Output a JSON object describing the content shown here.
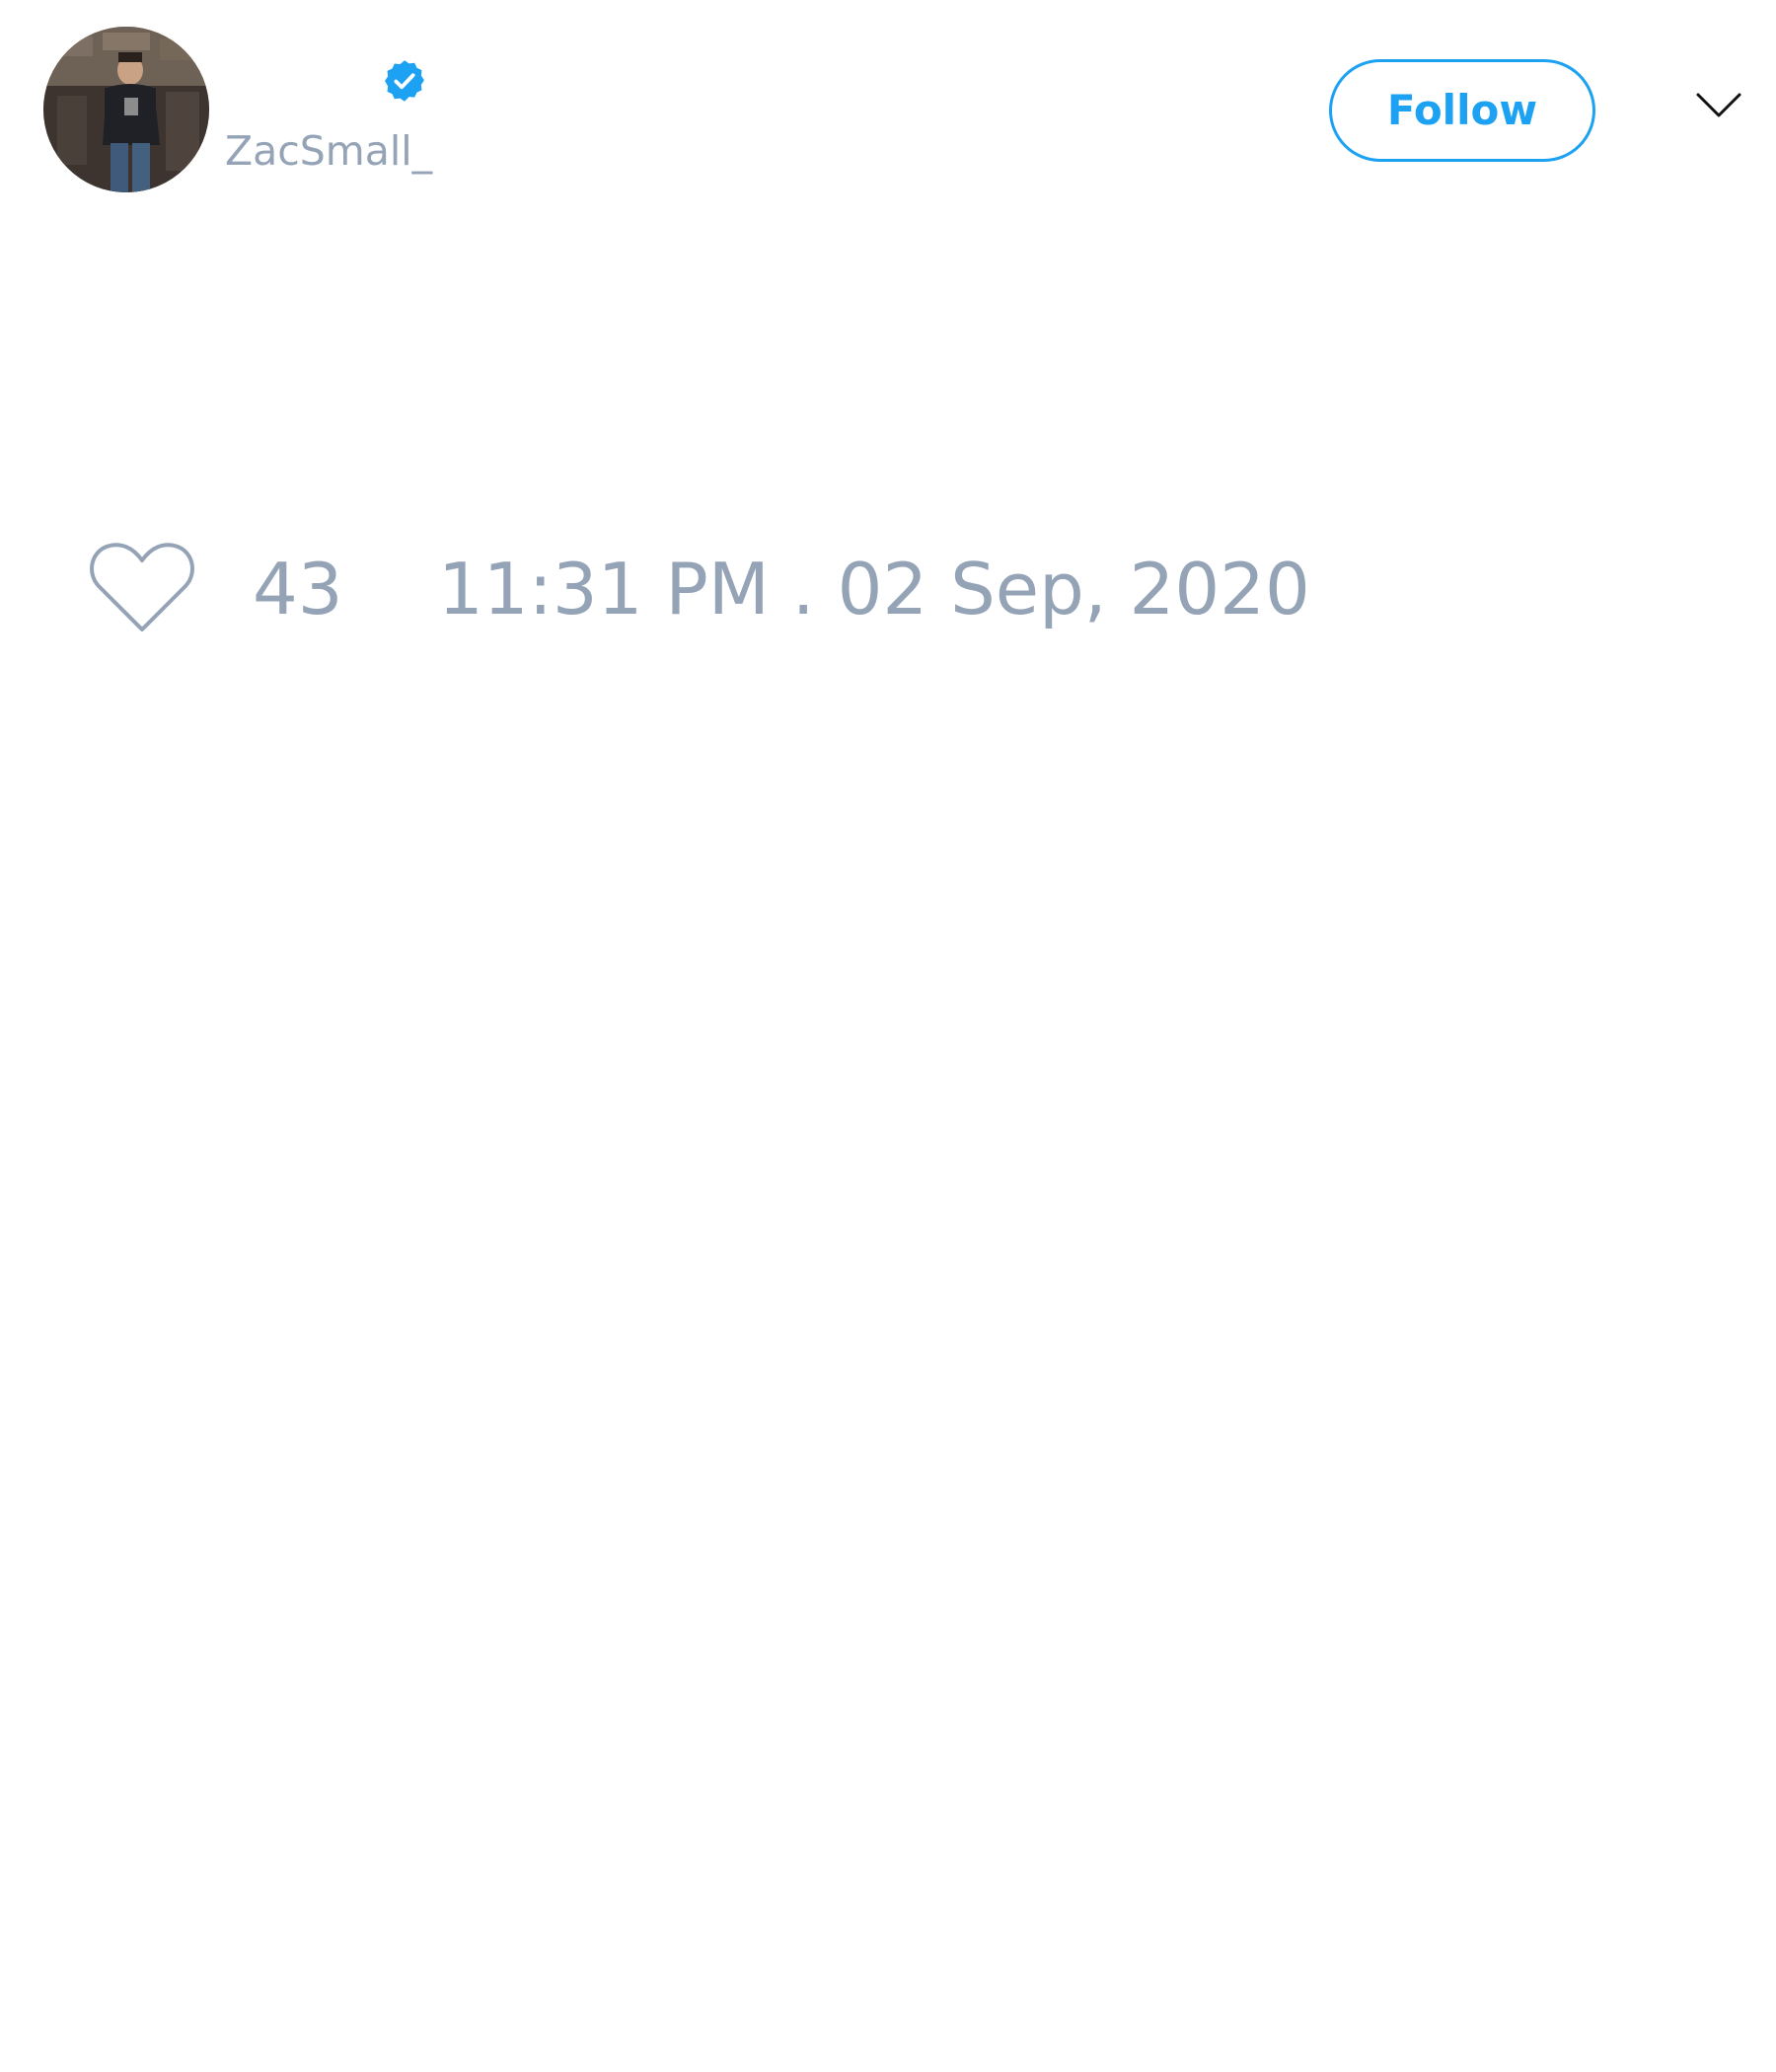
{
  "header": {
    "display_name": "",
    "handle": "ZacSmall_",
    "verified": true,
    "follow_label": "Follow",
    "menu_icon": "chevron-down-icon",
    "avatar_icon": "avatar"
  },
  "footer": {
    "like_icon": "heart-icon",
    "like_count": "43",
    "timestamp": "11:31 PM . 02 Sep, 2020"
  },
  "colors": {
    "accent": "#1da1f2",
    "muted_text": "#95a3b7",
    "background": "#ffffff"
  }
}
